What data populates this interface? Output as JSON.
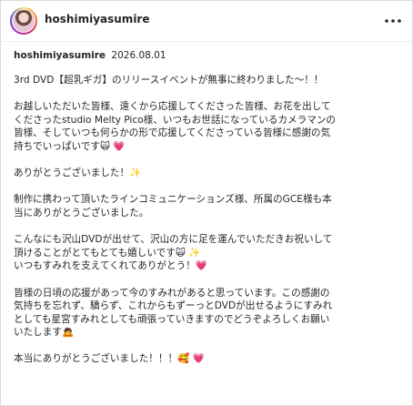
{
  "header": {
    "username": "hoshimiyasumire"
  },
  "post": {
    "author": "hoshimiyasumire",
    "date": "2026.08.01",
    "paragraphs": [
      [
        "3rd DVD【超乳ギガ】のリリースイベントが無事に終わりました〜！！"
      ],
      [
        "お越しいただいた皆様、遠くから応援してくださった皆様、お花を出して",
        "くださったstudio Melty Pico様、いつもお世話になっているカメラマンの",
        "皆様、そしていつも何らかの形で応援してくださっている皆様に感謝の気",
        "持ちでいっぱいです🙀 💗"
      ],
      [
        "ありがとうございました！✨"
      ],
      [
        "制作に携わって頂いたラインコミュニケーションズ様、所属のGCE様も本",
        "当にありがとうございました。"
      ],
      [
        "こんなにも沢山DVDが出せて、沢山の方に足を運んでいただきお祝いして",
        "頂けることがとてもとても嬉しいです🙀 ✨",
        "いつもすみれを支えてくれてありがとう！💗"
      ],
      [
        "皆様の日頃の応援があって今のすみれがあると思っています。この感謝の",
        "気持ちを忘れず、驕らず、これからもずーっとDVDが出せるようにすみれ",
        "としても星宮すみれとしても頑張っていきますのでどうぞよろしくお願い",
        "いたします🙇"
      ],
      [
        "本当にありがとうございました！！！🥰 💗"
      ]
    ]
  },
  "colors": {
    "text": "#262626",
    "border": "#dbdbdb"
  },
  "icons": {
    "more": "more-options-icon",
    "avatar": "profile-avatar"
  }
}
